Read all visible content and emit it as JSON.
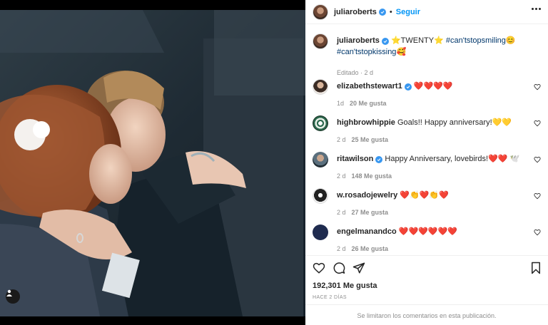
{
  "post": {
    "username": "juliaroberts",
    "follow_label": "Seguir",
    "separator": "•",
    "caption_parts": {
      "prefix": "⭐TWENTY⭐ ",
      "tag1": "#can'tstopsmiling",
      "emoji1": "😊",
      "tag2": "#can'tstopkissing",
      "emoji2": "🥰"
    },
    "caption_meta": "Editado · 2 d",
    "likes": "192,301 Me gusta",
    "time_ago": "HACE 2 DÍAS",
    "comments_limited": "Se limitaron los comentarios en esta publicación."
  },
  "comments": [
    {
      "user": "elizabethstewart1",
      "verified": true,
      "text": "❤️❤️❤️❤️",
      "time": "1d",
      "likes": "20 Me gusta"
    },
    {
      "user": "highbrowhippie",
      "verified": false,
      "text": "Goals!! Happy anniversary!💛💛",
      "time": "2 d",
      "likes": "25 Me gusta"
    },
    {
      "user": "ritawilson",
      "verified": true,
      "text": "Happy Anniversary, lovebirds!❤️❤️ 🕊️",
      "time": "2 d",
      "likes": "148 Me gusta"
    },
    {
      "user": "w.rosadojewelry",
      "verified": false,
      "text": "❤️👏❤️👏❤️",
      "time": "2 d",
      "likes": "27 Me gusta"
    },
    {
      "user": "engelmanandco",
      "verified": false,
      "text": "❤️❤️❤️❤️❤️❤️",
      "time": "2 d",
      "likes": "26 Me gusta"
    }
  ],
  "colors": {
    "accent": "#0095f6",
    "verified": "#3897f0",
    "muted": "#8e8e8e",
    "text": "#262626"
  },
  "icons": [
    "user-tag-icon",
    "verified-icon",
    "more-options-icon",
    "heart-icon",
    "comment-icon",
    "share-icon",
    "bookmark-icon"
  ]
}
